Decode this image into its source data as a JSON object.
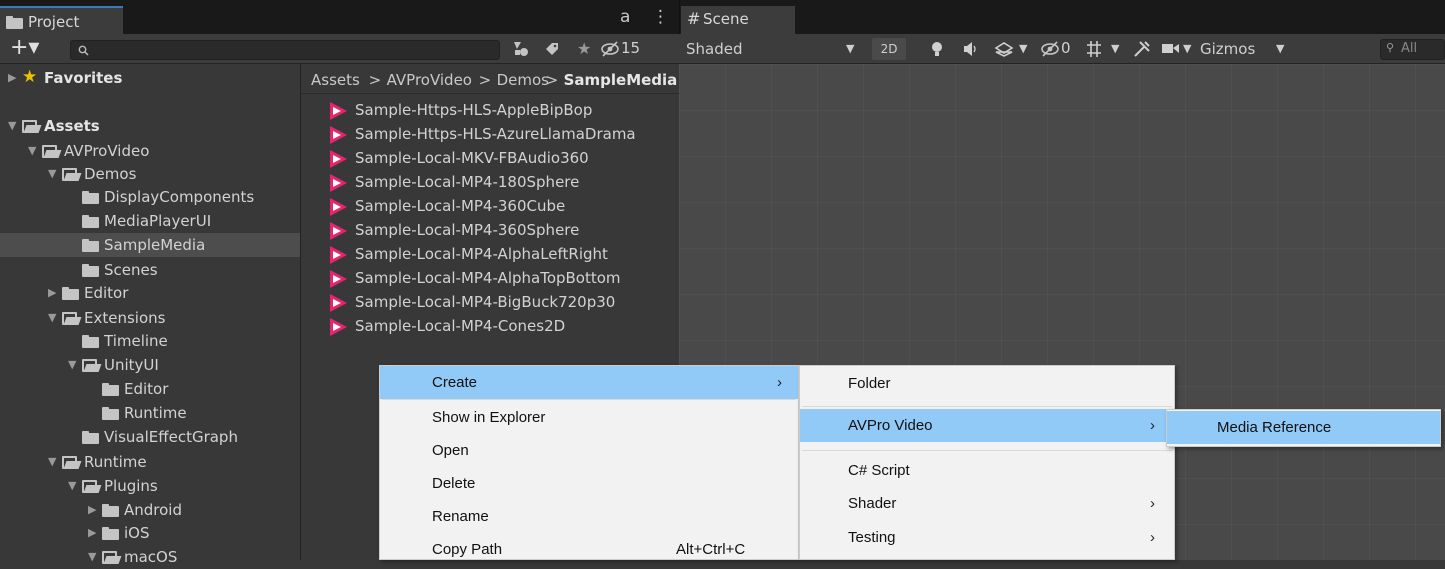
{
  "project": {
    "tab_label": "Project",
    "lock_glyph": "a",
    "more_glyph": "⋮",
    "add_glyph": "+▾",
    "hidden_count": "15",
    "tree": [
      {
        "label": "Favorites",
        "depth": 0,
        "expanded": false,
        "icon": "star-icon"
      },
      {
        "label": "Assets",
        "depth": 0,
        "expanded": true,
        "icon": "folder-open-icon"
      },
      {
        "label": "AVProVideo",
        "depth": 1,
        "expanded": true,
        "icon": "folder-open-icon"
      },
      {
        "label": "Demos",
        "depth": 2,
        "expanded": true,
        "icon": "folder-open-icon"
      },
      {
        "label": "DisplayComponents",
        "depth": 3,
        "icon": "folder-icon"
      },
      {
        "label": "MediaPlayerUI",
        "depth": 3,
        "icon": "folder-icon"
      },
      {
        "label": "SampleMedia",
        "depth": 3,
        "icon": "folder-icon",
        "selected": true
      },
      {
        "label": "Scenes",
        "depth": 3,
        "icon": "folder-icon"
      },
      {
        "label": "Editor",
        "depth": 2,
        "expanded": false,
        "icon": "folder-icon"
      },
      {
        "label": "Extensions",
        "depth": 2,
        "expanded": true,
        "icon": "folder-open-icon"
      },
      {
        "label": "Timeline",
        "depth": 3,
        "icon": "folder-icon"
      },
      {
        "label": "UnityUI",
        "depth": 3,
        "expanded": true,
        "icon": "folder-open-icon"
      },
      {
        "label": "Editor",
        "depth": 4,
        "icon": "folder-icon"
      },
      {
        "label": "Runtime",
        "depth": 4,
        "icon": "folder-icon"
      },
      {
        "label": "VisualEffectGraph",
        "depth": 3,
        "icon": "folder-icon"
      },
      {
        "label": "Runtime",
        "depth": 2,
        "expanded": true,
        "icon": "folder-open-icon"
      },
      {
        "label": "Plugins",
        "depth": 3,
        "expanded": true,
        "icon": "folder-open-icon"
      },
      {
        "label": "Android",
        "depth": 4,
        "expanded": false,
        "icon": "folder-icon"
      },
      {
        "label": "iOS",
        "depth": 4,
        "expanded": false,
        "icon": "folder-icon"
      },
      {
        "label": "macOS",
        "depth": 4,
        "expanded": true,
        "icon": "folder-open-icon"
      }
    ],
    "breadcrumb": [
      "Assets",
      "AVProVideo",
      "Demos",
      "SampleMedia"
    ],
    "breadcrumb_sep": ">",
    "files": [
      "Sample-Https-HLS-AppleBipBop",
      "Sample-Https-HLS-AzureLlamaDrama",
      "Sample-Local-MKV-FBAudio360",
      "Sample-Local-MP4-180Sphere",
      "Sample-Local-MP4-360Cube",
      "Sample-Local-MP4-360Sphere",
      "Sample-Local-MP4-AlphaLeftRight",
      "Sample-Local-MP4-AlphaTopBottom",
      "Sample-Local-MP4-BigBuck720p30",
      "Sample-Local-MP4-Cones2D"
    ]
  },
  "scene": {
    "tab_label": "Scene",
    "tab_glyph": "#",
    "shading_mode": "Shaded",
    "mode_2d": "2D",
    "hidden_count": "0",
    "gizmos_label": "Gizmos",
    "search_placeholder": "All"
  },
  "context_menu": {
    "items": [
      {
        "label": "Create",
        "submenu": true,
        "highlighted": true
      },
      {
        "label": "Show in Explorer"
      },
      {
        "label": "Open"
      },
      {
        "label": "Delete"
      },
      {
        "label": "Rename"
      },
      {
        "label": "Copy Path",
        "shortcut": "Alt+Ctrl+C"
      }
    ]
  },
  "create_menu": {
    "items": [
      {
        "label": "Folder"
      },
      {
        "label": "AVPro Video",
        "submenu": true,
        "highlighted": true
      },
      {
        "label": "C# Script"
      },
      {
        "label": "Shader",
        "submenu": true
      },
      {
        "label": "Testing",
        "submenu": true
      }
    ]
  },
  "avpro_menu": {
    "items": [
      {
        "label": "Media Reference",
        "highlighted": true
      }
    ]
  },
  "colors": {
    "menu_highlight": "#91c9f7",
    "media_icon_pink": "#e8246e",
    "selection_row": "#4d4d4d"
  }
}
